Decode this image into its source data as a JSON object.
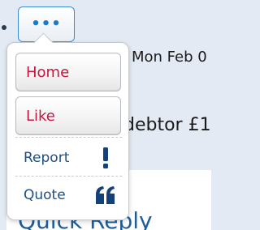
{
  "post": {
    "bullet": "•",
    "more_button_label": "•••",
    "date_fragment": "Mon Feb 0",
    "text_fragment": "debtor £1",
    "quick_reply_fragment": "Quick Reply"
  },
  "menu": {
    "items": [
      {
        "label": "Home",
        "icon": null
      },
      {
        "label": "Like",
        "icon": null
      },
      {
        "label": "Report",
        "icon": "exclamation-icon"
      },
      {
        "label": "Quote",
        "icon": "quote-icon"
      }
    ]
  },
  "colors": {
    "page_background": "#e3eaf3",
    "accent_blue": "#1f79c9",
    "menu_button_text": "#c8173f",
    "menu_link_text": "#1c4f86",
    "icon_color": "#14417a"
  }
}
